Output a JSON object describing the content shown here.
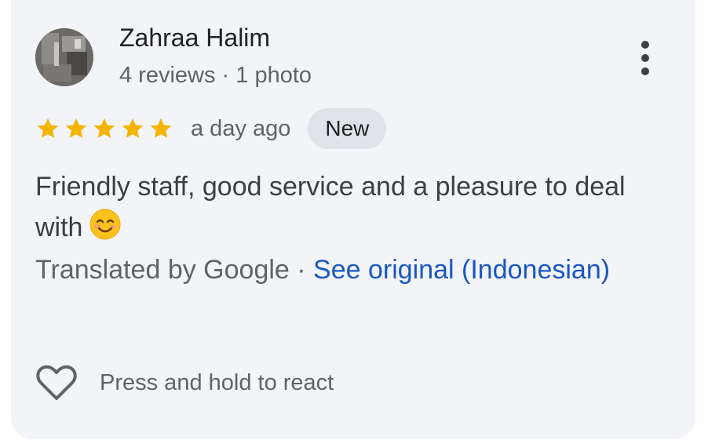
{
  "review": {
    "reviewer": {
      "name": "Zahraa Halim",
      "meta": "4 reviews · 1 photo",
      "avatar_icon": "profile-photo"
    },
    "rating": {
      "stars": 5,
      "max_stars": 5,
      "star_color": "#f5b400"
    },
    "time_ago": "a day ago",
    "badge": "New",
    "text": "Friendly staff, good service and a pleasure to deal with",
    "emoji_icon": "smiling-face-emoji",
    "translation": {
      "label": "Translated by Google · ",
      "link": "See original (Indonesian)",
      "link_color": "#1a56c4"
    },
    "react": {
      "icon": "heart-outline-icon",
      "label": "Press and hold to react"
    },
    "menu_icon": "more-vert-icon"
  }
}
